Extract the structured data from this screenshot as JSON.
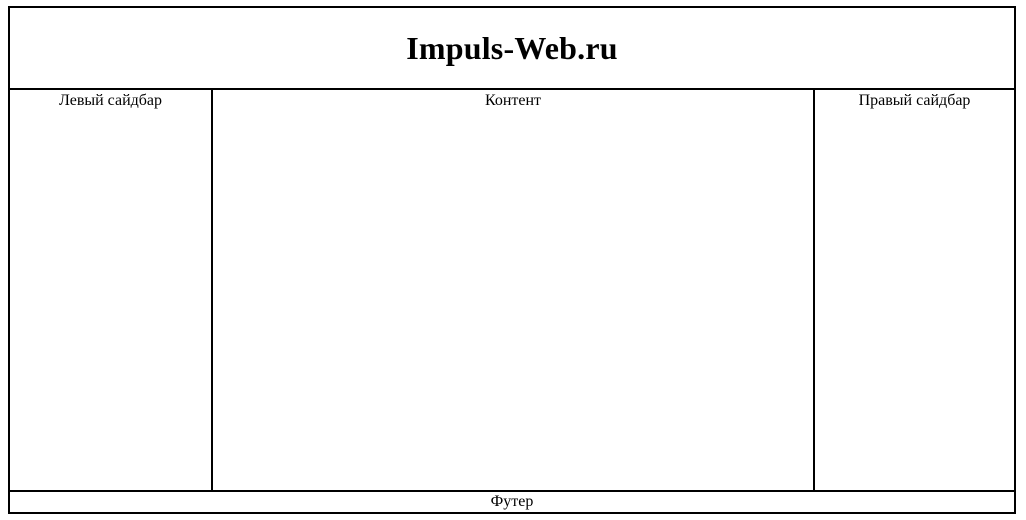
{
  "header": {
    "title": "Impuls-Web.ru"
  },
  "sidebar_left": {
    "label": "Левый сайдбар"
  },
  "content": {
    "label": "Контент"
  },
  "sidebar_right": {
    "label": "Правый сайдбар"
  },
  "footer": {
    "label": "Футер"
  },
  "colors": {
    "background": "#ffffff",
    "border": "#000000",
    "text": "#000000"
  }
}
